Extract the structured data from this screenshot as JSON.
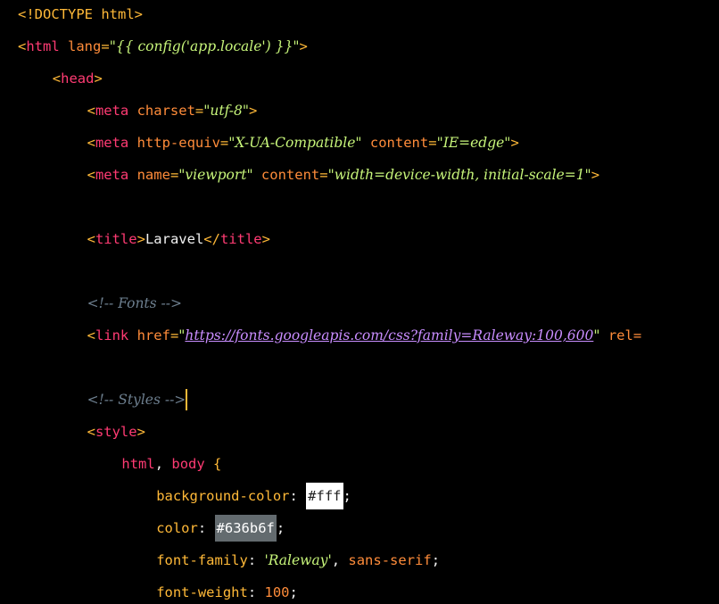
{
  "editor": {
    "lines": [
      {
        "indent": "",
        "tokens": [
          {
            "t": "<!DOCTYPE html>",
            "c": "c-punct"
          }
        ]
      },
      {
        "indent": "",
        "tokens": [
          {
            "t": "<",
            "c": "c-punct"
          },
          {
            "t": "html",
            "c": "c-tag"
          },
          {
            "t": " lang",
            "c": "c-attr"
          },
          {
            "t": "=",
            "c": "c-punct"
          },
          {
            "t": "\"{{ config('app.locale') }}\"",
            "c": "c-str"
          },
          {
            "t": ">",
            "c": "c-punct"
          }
        ]
      },
      {
        "indent": "    ",
        "tokens": [
          {
            "t": "<",
            "c": "c-punct"
          },
          {
            "t": "head",
            "c": "c-tag"
          },
          {
            "t": ">",
            "c": "c-punct"
          }
        ]
      },
      {
        "indent": "        ",
        "tokens": [
          {
            "t": "<",
            "c": "c-punct"
          },
          {
            "t": "meta",
            "c": "c-tag"
          },
          {
            "t": " charset",
            "c": "c-attr"
          },
          {
            "t": "=",
            "c": "c-punct"
          },
          {
            "t": "\"utf-8\"",
            "c": "c-str"
          },
          {
            "t": ">",
            "c": "c-punct"
          }
        ]
      },
      {
        "indent": "        ",
        "tokens": [
          {
            "t": "<",
            "c": "c-punct"
          },
          {
            "t": "meta",
            "c": "c-tag"
          },
          {
            "t": " http-equiv",
            "c": "c-attr"
          },
          {
            "t": "=",
            "c": "c-punct"
          },
          {
            "t": "\"X-UA-Compatible\"",
            "c": "c-str"
          },
          {
            "t": " content",
            "c": "c-attr"
          },
          {
            "t": "=",
            "c": "c-punct"
          },
          {
            "t": "\"IE=edge\"",
            "c": "c-str"
          },
          {
            "t": ">",
            "c": "c-punct"
          }
        ]
      },
      {
        "indent": "        ",
        "tokens": [
          {
            "t": "<",
            "c": "c-punct"
          },
          {
            "t": "meta",
            "c": "c-tag"
          },
          {
            "t": " name",
            "c": "c-attr"
          },
          {
            "t": "=",
            "c": "c-punct"
          },
          {
            "t": "\"viewport\"",
            "c": "c-str"
          },
          {
            "t": " content",
            "c": "c-attr"
          },
          {
            "t": "=",
            "c": "c-punct"
          },
          {
            "t": "\"width=device-width, initial-scale=1\"",
            "c": "c-str"
          },
          {
            "t": ">",
            "c": "c-punct"
          }
        ]
      },
      {
        "indent": "",
        "tokens": []
      },
      {
        "indent": "        ",
        "tokens": [
          {
            "t": "<",
            "c": "c-punct"
          },
          {
            "t": "title",
            "c": "c-tag"
          },
          {
            "t": ">",
            "c": "c-punct"
          },
          {
            "t": "Laravel",
            "c": "c-plain"
          },
          {
            "t": "</",
            "c": "c-punct"
          },
          {
            "t": "title",
            "c": "c-tag"
          },
          {
            "t": ">",
            "c": "c-punct"
          }
        ]
      },
      {
        "indent": "",
        "tokens": []
      },
      {
        "indent": "        ",
        "tokens": [
          {
            "t": "<!-- Fonts -->",
            "c": "c-comment"
          }
        ]
      },
      {
        "indent": "        ",
        "tokens": [
          {
            "t": "<",
            "c": "c-punct"
          },
          {
            "t": "link",
            "c": "c-tag"
          },
          {
            "t": " href",
            "c": "c-attr"
          },
          {
            "t": "=",
            "c": "c-punct"
          },
          {
            "t": "\"",
            "c": "c-str"
          },
          {
            "t": "https://fonts.googleapis.com/css?family=Raleway:100,600",
            "c": "c-link"
          },
          {
            "t": "\"",
            "c": "c-str"
          },
          {
            "t": " rel=",
            "c": "c-attr"
          }
        ]
      },
      {
        "indent": "",
        "tokens": []
      },
      {
        "indent": "        ",
        "tokens": [
          {
            "t": "<!-- Styles -->",
            "c": "c-comment"
          }
        ],
        "caret": true
      },
      {
        "indent": "        ",
        "tokens": [
          {
            "t": "<",
            "c": "c-punct"
          },
          {
            "t": "style",
            "c": "c-tag"
          },
          {
            "t": ">",
            "c": "c-punct"
          }
        ]
      },
      {
        "indent": "            ",
        "tokens": [
          {
            "t": "html",
            "c": "c-sel"
          },
          {
            "t": ", ",
            "c": "c-plain"
          },
          {
            "t": "body",
            "c": "c-sel"
          },
          {
            "t": " {",
            "c": "c-brace"
          }
        ]
      },
      {
        "indent": "                ",
        "tokens": [
          {
            "t": "background-color",
            "c": "c-prop"
          },
          {
            "t": ": ",
            "c": "c-colon"
          },
          {
            "t": "#fff",
            "c": "c-swatch-white"
          },
          {
            "t": ";",
            "c": "c-plain"
          }
        ]
      },
      {
        "indent": "                ",
        "tokens": [
          {
            "t": "color",
            "c": "c-prop"
          },
          {
            "t": ": ",
            "c": "c-colon"
          },
          {
            "t": "#636b6f",
            "c": "c-swatch-gray"
          },
          {
            "t": ";",
            "c": "c-plain"
          }
        ]
      },
      {
        "indent": "                ",
        "tokens": [
          {
            "t": "font-family",
            "c": "c-prop"
          },
          {
            "t": ": ",
            "c": "c-colon"
          },
          {
            "t": "'Raleway'",
            "c": "c-str"
          },
          {
            "t": ", ",
            "c": "c-plain"
          },
          {
            "t": "sans-serif",
            "c": "c-keyword-val"
          },
          {
            "t": ";",
            "c": "c-plain"
          }
        ]
      },
      {
        "indent": "                ",
        "tokens": [
          {
            "t": "font-weight",
            "c": "c-prop"
          },
          {
            "t": ": ",
            "c": "c-colon"
          },
          {
            "t": "100",
            "c": "c-num"
          },
          {
            "t": ";",
            "c": "c-plain"
          }
        ]
      }
    ]
  },
  "colors": {
    "background": "#000000",
    "punctuation": "#ffb938",
    "tag": "#ff3b73",
    "attribute": "#ff8c3a",
    "string": "#c7f57a",
    "comment": "#6d7f8f",
    "link": "#c98dff",
    "caret": "#ffb938"
  }
}
